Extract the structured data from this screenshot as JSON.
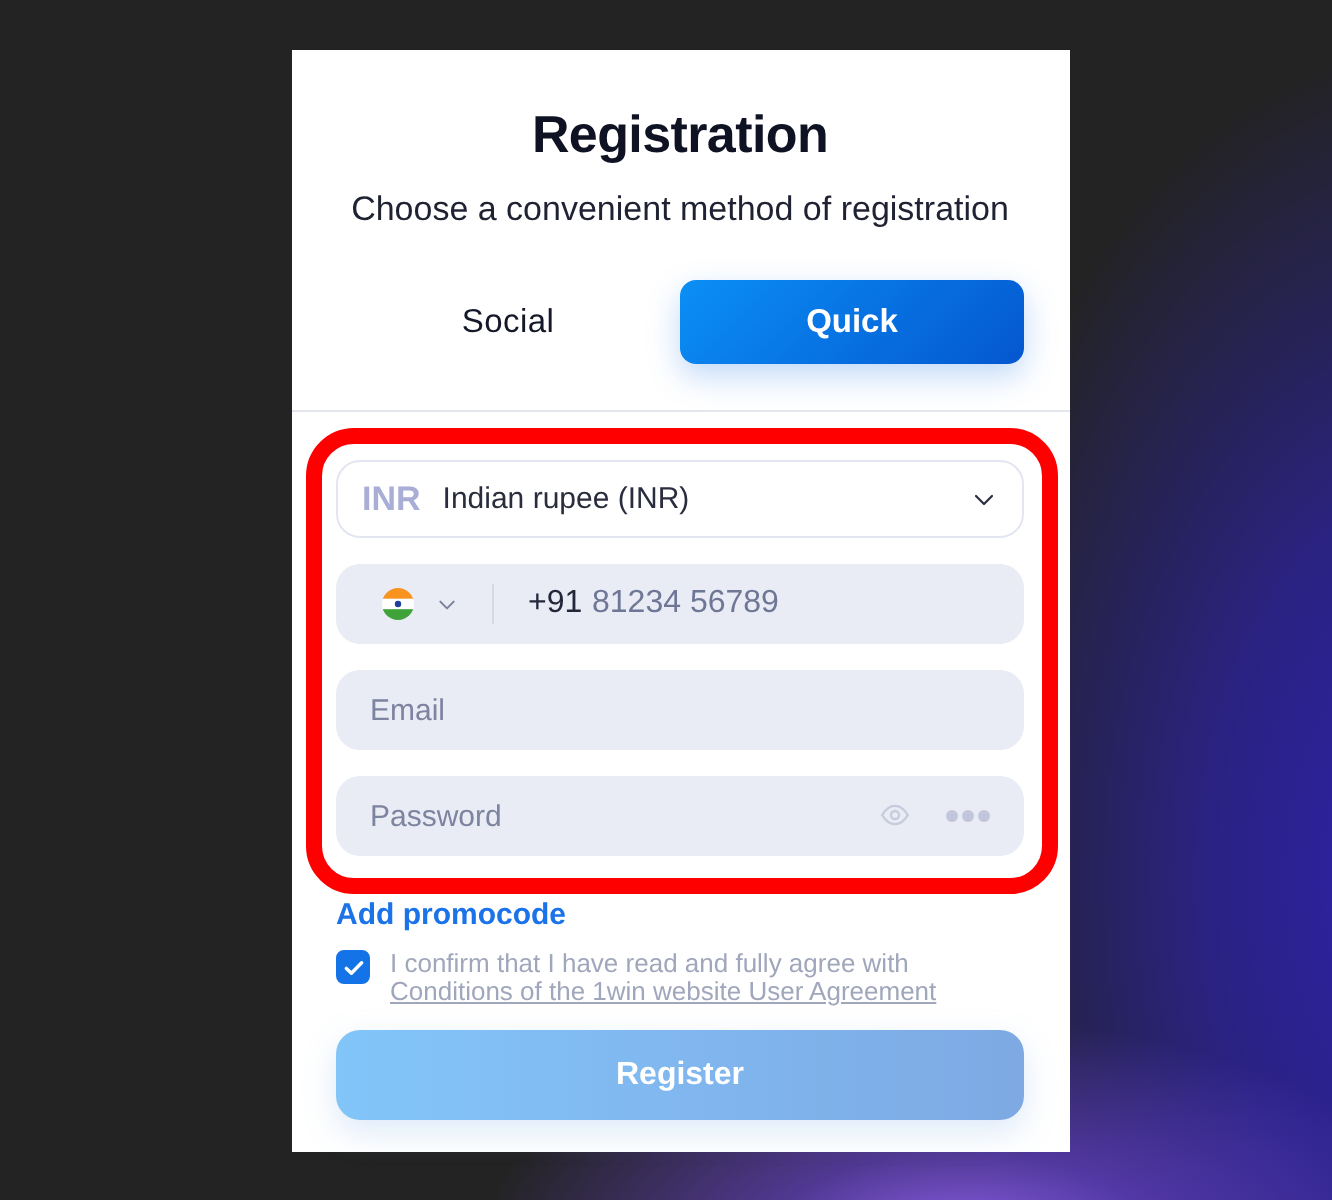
{
  "title": "Registration",
  "subtitle": "Choose a convenient method of registration",
  "tabs": [
    {
      "label": "Social",
      "selected": false
    },
    {
      "label": "Quick",
      "selected": true
    }
  ],
  "currency": {
    "code": "INR",
    "value": "Indian rupee (INR)"
  },
  "phone": {
    "dial_code": "+91",
    "placeholder": "81234 56789"
  },
  "email": {
    "placeholder": "Email"
  },
  "password": {
    "placeholder": "Password"
  },
  "promocode_link": "Add promocode",
  "agreement": {
    "checked": true,
    "text": "I confirm that I have read and fully agree with",
    "link": "Conditions of the 1win website User Agreement"
  },
  "register_button": {
    "label": "Register",
    "disabled": true
  }
}
